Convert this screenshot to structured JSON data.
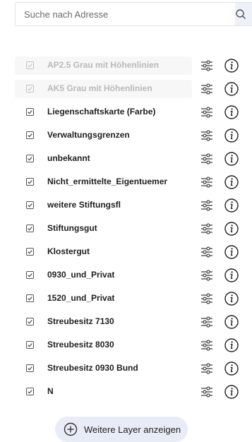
{
  "search": {
    "placeholder": "Suche nach Adresse"
  },
  "layers": [
    {
      "label": "AP2.5 Grau mit Höhenlinien",
      "checked": true,
      "disabled": true
    },
    {
      "label": "AK5 Grau mit Höhenlinien",
      "checked": true,
      "disabled": true
    },
    {
      "label": "Liegenschaftskarte (Farbe)",
      "checked": true,
      "disabled": false
    },
    {
      "label": "Verwaltungsgrenzen",
      "checked": true,
      "disabled": false
    },
    {
      "label": "unbekannt",
      "checked": true,
      "disabled": false
    },
    {
      "label": "Nicht_ermittelte_Eigentuemer",
      "checked": true,
      "disabled": false
    },
    {
      "label": "weitere Stiftungsfl",
      "checked": true,
      "disabled": false
    },
    {
      "label": "Stiftungsgut",
      "checked": true,
      "disabled": false
    },
    {
      "label": "Klostergut",
      "checked": true,
      "disabled": false
    },
    {
      "label": "0930_und_Privat",
      "checked": true,
      "disabled": false
    },
    {
      "label": "1520_und_Privat",
      "checked": true,
      "disabled": false
    },
    {
      "label": "Streubesitz 7130",
      "checked": true,
      "disabled": false
    },
    {
      "label": "Streubesitz 8030",
      "checked": true,
      "disabled": false
    },
    {
      "label": "Streubesitz 0930 Bund",
      "checked": true,
      "disabled": false
    },
    {
      "label": "N",
      "checked": true,
      "disabled": false
    }
  ],
  "more_button": {
    "label": "Weitere Layer anzeigen"
  }
}
